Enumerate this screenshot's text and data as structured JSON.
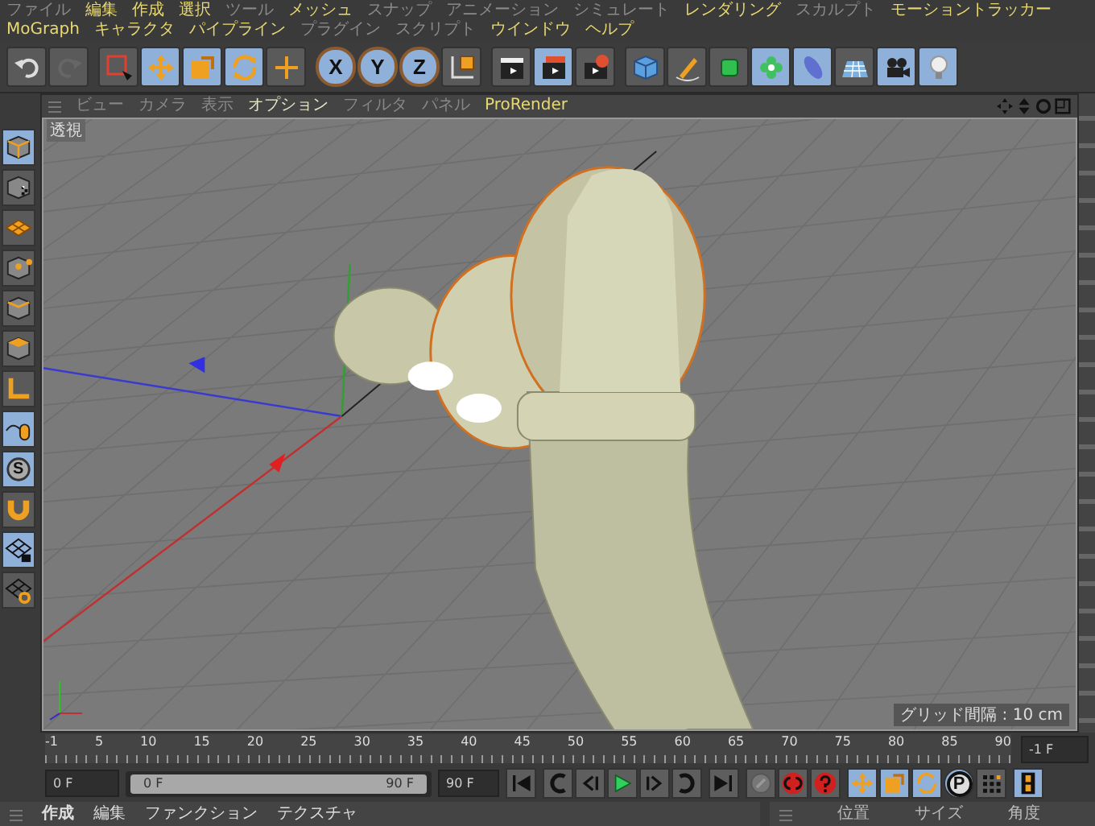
{
  "menu": [
    {
      "label": "ファイル",
      "disabled": true
    },
    {
      "label": "編集",
      "disabled": false
    },
    {
      "label": "作成",
      "disabled": false
    },
    {
      "label": "選択",
      "disabled": false
    },
    {
      "label": "ツール",
      "disabled": true
    },
    {
      "label": "メッシュ",
      "disabled": false
    },
    {
      "label": "スナップ",
      "disabled": true
    },
    {
      "label": "アニメーション",
      "disabled": true
    },
    {
      "label": "シミュレート",
      "disabled": true
    },
    {
      "label": "レンダリング",
      "disabled": false
    },
    {
      "label": "スカルプト",
      "disabled": true
    },
    {
      "label": "モーショントラッカー",
      "disabled": false
    },
    {
      "label": "MoGraph",
      "disabled": false
    },
    {
      "label": "キャラクタ",
      "disabled": false
    },
    {
      "label": "パイプライン",
      "disabled": false
    },
    {
      "label": "プラグイン",
      "disabled": true
    },
    {
      "label": "スクリプト",
      "disabled": true
    },
    {
      "label": "ウインドウ",
      "disabled": false
    },
    {
      "label": "ヘルプ",
      "disabled": false
    }
  ],
  "toolbar": [
    {
      "kind": "undo",
      "selected": false
    },
    {
      "kind": "redo",
      "selected": false
    },
    {
      "kind": "select",
      "selected": false
    },
    {
      "kind": "move",
      "selected": true
    },
    {
      "kind": "scale",
      "selected": true
    },
    {
      "kind": "rotate",
      "selected": true
    },
    {
      "kind": "add",
      "selected": false
    },
    {
      "kind": "x",
      "label": "X",
      "selected": true
    },
    {
      "kind": "y",
      "label": "Y",
      "selected": true
    },
    {
      "kind": "z",
      "label": "Z",
      "selected": true
    },
    {
      "kind": "coords",
      "selected": false
    },
    {
      "kind": "render-view",
      "selected": false
    },
    {
      "kind": "render",
      "selected": true
    },
    {
      "kind": "render-settings",
      "selected": false
    },
    {
      "kind": "cube",
      "selected": false
    },
    {
      "kind": "pen",
      "selected": false
    },
    {
      "kind": "subdivide",
      "selected": false
    },
    {
      "kind": "cloner",
      "selected": true
    },
    {
      "kind": "deformer",
      "selected": true
    },
    {
      "kind": "floor",
      "selected": false
    },
    {
      "kind": "camera",
      "selected": true
    },
    {
      "kind": "light",
      "selected": true
    }
  ],
  "side_tools": [
    {
      "kind": "model",
      "selected": true
    },
    {
      "kind": "texture",
      "selected": false
    },
    {
      "kind": "workplane",
      "selected": false
    },
    {
      "kind": "points",
      "selected": false
    },
    {
      "kind": "edges",
      "selected": false
    },
    {
      "kind": "polygons",
      "selected": false
    },
    {
      "kind": "axis",
      "selected": false
    },
    {
      "kind": "tweak",
      "selected": true
    },
    {
      "kind": "solo",
      "label": "S",
      "selected": true
    },
    {
      "kind": "snap",
      "selected": false
    },
    {
      "kind": "lock",
      "selected": true
    },
    {
      "kind": "planar",
      "selected": false
    }
  ],
  "viewport": {
    "menu": [
      {
        "label": "ビュー",
        "disabled": true
      },
      {
        "label": "カメラ",
        "disabled": true
      },
      {
        "label": "表示",
        "disabled": true
      },
      {
        "label": "オプション",
        "disabled": false
      },
      {
        "label": "フィルタ",
        "disabled": true
      },
      {
        "label": "パネル",
        "disabled": true
      },
      {
        "label": "ProRender",
        "disabled": false
      }
    ],
    "camera_label": "透視",
    "grid_label": "グリッド間隔 : 10 cm"
  },
  "timeline": {
    "ticks": [
      "-1",
      "5",
      "10",
      "15",
      "20",
      "25",
      "30",
      "35",
      "40",
      "45",
      "50",
      "55",
      "60",
      "65",
      "70",
      "75",
      "80",
      "85",
      "90"
    ],
    "current_frame": "-1 F",
    "start_field": "0 F",
    "range_start": "0 F",
    "range_end": "90 F",
    "level": 1,
    "end_field": "90 F"
  },
  "transport": [
    {
      "kind": "first",
      "selected": false
    },
    {
      "kind": "prev-key",
      "selected": false
    },
    {
      "kind": "prev",
      "selected": false
    },
    {
      "kind": "play",
      "selected": false
    },
    {
      "kind": "next",
      "selected": false
    },
    {
      "kind": "next-key",
      "selected": false
    },
    {
      "kind": "last",
      "selected": false
    },
    {
      "kind": "keyframe",
      "selected": false
    },
    {
      "kind": "record",
      "selected": false
    },
    {
      "kind": "help",
      "selected": false
    },
    {
      "kind": "pos",
      "selected": true
    },
    {
      "kind": "scl",
      "selected": true
    },
    {
      "kind": "rot",
      "selected": true
    },
    {
      "kind": "param",
      "label": "P",
      "selected": true
    },
    {
      "kind": "pla",
      "selected": false
    },
    {
      "kind": "timeline",
      "selected": true
    }
  ],
  "material_menu": [
    "作成",
    "編集",
    "ファンクション",
    "テクスチャ"
  ],
  "coords_headers": [
    "位置",
    "サイズ",
    "角度"
  ]
}
